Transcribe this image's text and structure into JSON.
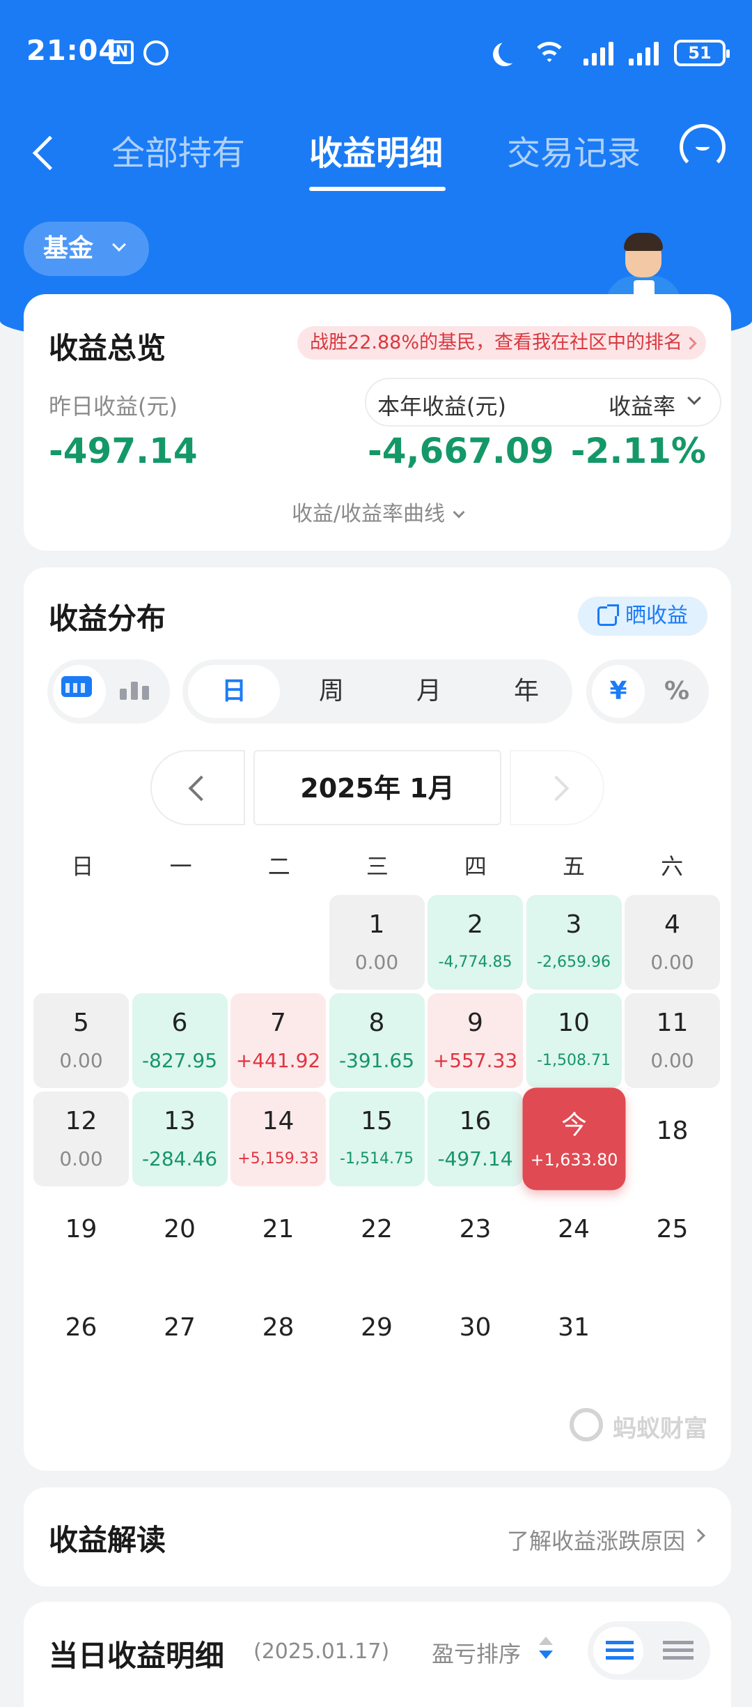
{
  "status_bar": {
    "time": "21:04",
    "nfc": "N",
    "battery": "51"
  },
  "nav": {
    "tabs": [
      {
        "label": "全部持有"
      },
      {
        "label": "收益明细"
      },
      {
        "label": "交易记录"
      }
    ]
  },
  "filter": {
    "label": "基金"
  },
  "overview": {
    "title": "收益总览",
    "rank_text": "战胜22.88%的基民，查看我在社区中的排名",
    "yesterday_label": "昨日收益(元)",
    "yesterday_value": "-497.14",
    "year_label": "本年收益(元)",
    "year_value": "-4,667.09",
    "rate_label": "收益率",
    "rate_value": "-2.11%",
    "curve_label": "收益/收益率曲线",
    "colors": {
      "loss": "#149868",
      "gain": "#e0353f"
    }
  },
  "distribution": {
    "title": "收益分布",
    "share_label": "晒收益",
    "periods": [
      "日",
      "周",
      "月",
      "年"
    ],
    "units": [
      "¥",
      "%"
    ],
    "month": "2025年 1月",
    "weekdays": [
      "日",
      "一",
      "二",
      "三",
      "四",
      "五",
      "六"
    ],
    "days": [
      {
        "day": "",
        "value": "",
        "type": "empty"
      },
      {
        "day": "",
        "value": "",
        "type": "empty"
      },
      {
        "day": "",
        "value": "",
        "type": "empty"
      },
      {
        "day": "1",
        "value": "0.00",
        "type": "neutral"
      },
      {
        "day": "2",
        "value": "-4,774.85",
        "type": "loss small"
      },
      {
        "day": "3",
        "value": "-2,659.96",
        "type": "loss small"
      },
      {
        "day": "4",
        "value": "0.00",
        "type": "neutral"
      },
      {
        "day": "5",
        "value": "0.00",
        "type": "neutral"
      },
      {
        "day": "6",
        "value": "-827.95",
        "type": "loss"
      },
      {
        "day": "7",
        "value": "+441.92",
        "type": "gain"
      },
      {
        "day": "8",
        "value": "-391.65",
        "type": "loss"
      },
      {
        "day": "9",
        "value": "+557.33",
        "type": "gain"
      },
      {
        "day": "10",
        "value": "-1,508.71",
        "type": "loss small"
      },
      {
        "day": "11",
        "value": "0.00",
        "type": "neutral"
      },
      {
        "day": "12",
        "value": "0.00",
        "type": "neutral"
      },
      {
        "day": "13",
        "value": "-284.46",
        "type": "loss"
      },
      {
        "day": "14",
        "value": "+5,159.33",
        "type": "gain small"
      },
      {
        "day": "15",
        "value": "-1,514.75",
        "type": "loss small"
      },
      {
        "day": "16",
        "value": "-497.14",
        "type": "loss"
      },
      {
        "day": "今",
        "value": "+1,633.80",
        "type": "today"
      },
      {
        "day": "18",
        "value": "",
        "type": "plain"
      },
      {
        "day": "19",
        "value": "",
        "type": "plain"
      },
      {
        "day": "20",
        "value": "",
        "type": "plain"
      },
      {
        "day": "21",
        "value": "",
        "type": "plain"
      },
      {
        "day": "22",
        "value": "",
        "type": "plain"
      },
      {
        "day": "23",
        "value": "",
        "type": "plain"
      },
      {
        "day": "24",
        "value": "",
        "type": "plain"
      },
      {
        "day": "25",
        "value": "",
        "type": "plain"
      },
      {
        "day": "26",
        "value": "",
        "type": "plain"
      },
      {
        "day": "27",
        "value": "",
        "type": "plain"
      },
      {
        "day": "28",
        "value": "",
        "type": "plain"
      },
      {
        "day": "29",
        "value": "",
        "type": "plain"
      },
      {
        "day": "30",
        "value": "",
        "type": "plain"
      },
      {
        "day": "31",
        "value": "",
        "type": "plain"
      }
    ],
    "watermark": "蚂蚁财富"
  },
  "interpretation": {
    "title": "收益解读",
    "link": "了解收益涨跌原因"
  },
  "daily": {
    "title": "当日收益明细",
    "date": "(2025.01.17)",
    "sort_label": "盈亏排序"
  }
}
